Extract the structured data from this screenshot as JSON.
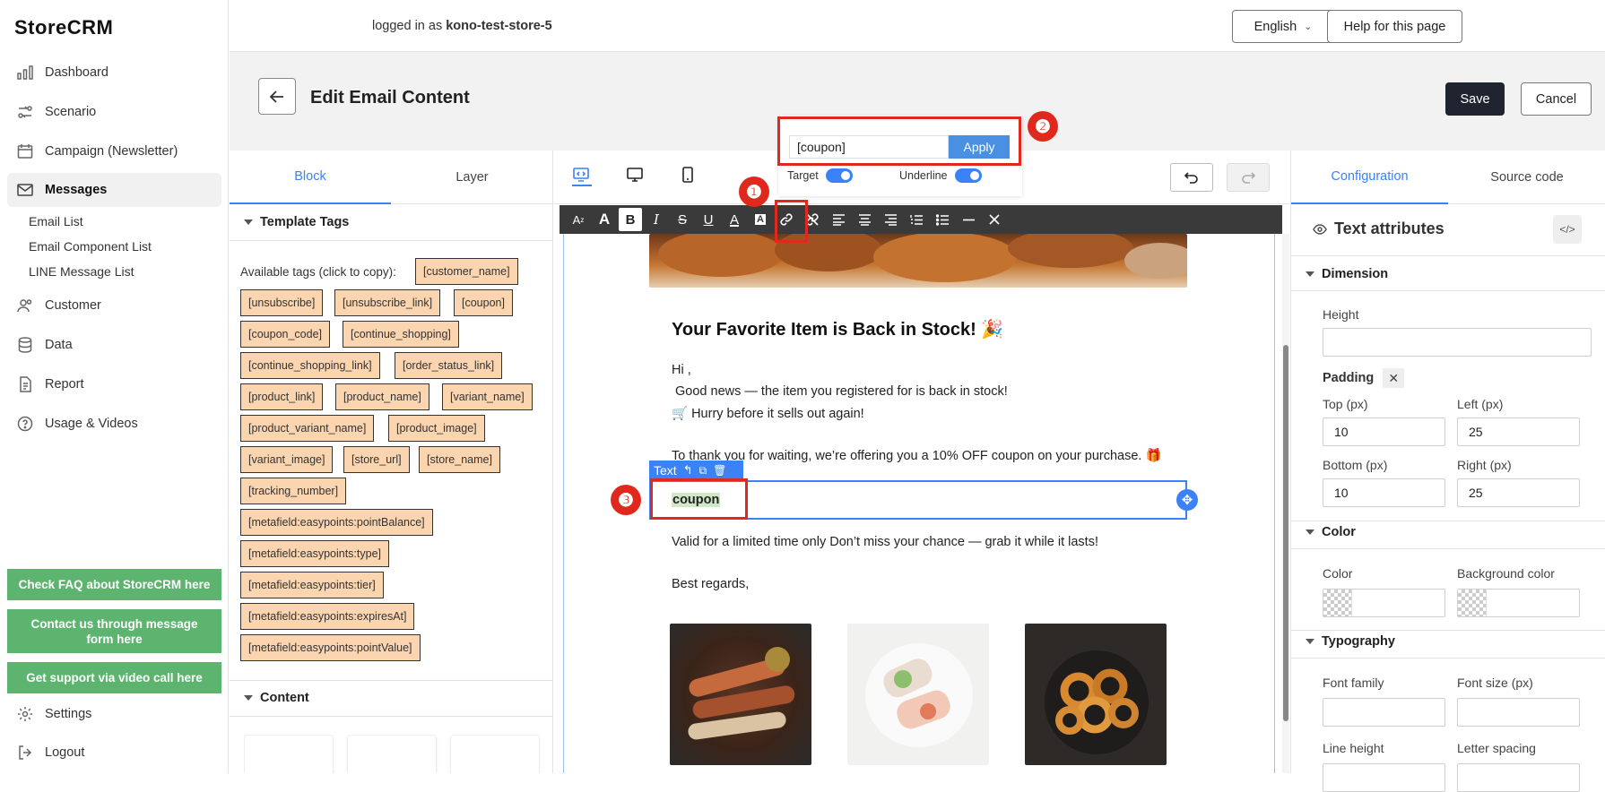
{
  "app": {
    "logo": "StoreCRM"
  },
  "sidebar": {
    "nav": [
      {
        "label": "Dashboard",
        "icon": "dashboard-icon"
      },
      {
        "label": "Scenario",
        "icon": "scenario-icon"
      },
      {
        "label": "Campaign (Newsletter)",
        "icon": "calendar-icon"
      },
      {
        "label": "Messages",
        "icon": "mail-icon"
      },
      {
        "label": "Customer",
        "icon": "users-icon"
      },
      {
        "label": "Data",
        "icon": "database-icon"
      },
      {
        "label": "Report",
        "icon": "report-icon"
      },
      {
        "label": "Usage & Videos",
        "icon": "help-circle-icon"
      }
    ],
    "sub_items": [
      "Email List",
      "Email Component List",
      "LINE Message List"
    ],
    "help_buttons": [
      "Check FAQ about StoreCRM here",
      "Contact us through message form here",
      "Get support via video call here"
    ],
    "settings_label": "Settings",
    "logout_label": "Logout"
  },
  "topbar": {
    "login_prefix": "logged in as ",
    "store_name": "kono-test-store-5",
    "language": "English",
    "help_label": "Help for this page"
  },
  "page": {
    "title": "Edit Email Content",
    "save_label": "Save",
    "cancel_label": "Cancel"
  },
  "left_panel": {
    "tabs": [
      "Block",
      "Layer"
    ],
    "template_tags_header": "Template Tags",
    "tags_intro": "Available tags (click to copy):",
    "tags": [
      "[customer_name]",
      "[unsubscribe]",
      "[unsubscribe_link]",
      "[coupon]",
      "[coupon_code]",
      "[continue_shopping]",
      "[continue_shopping_link]",
      "[order_status_link]",
      "[product_link]",
      "[product_name]",
      "[variant_name]",
      "[product_variant_name]",
      "[product_image]",
      "[variant_image]",
      "[store_url]",
      "[store_name]",
      "[tracking_number]",
      "[metafield:easypoints:pointBalance]",
      "[metafield:easypoints:type]",
      "[metafield:easypoints:tier]",
      "[metafield:easypoints:expiresAt]",
      "[metafield:easypoints:pointValue]"
    ],
    "content_header": "Content"
  },
  "link_popup": {
    "input_value": "[coupon]",
    "apply_label": "Apply",
    "target_label": "Target",
    "underline_label": "Underline"
  },
  "annotations": [
    "❶",
    "❷",
    "❸"
  ],
  "email": {
    "heading": "Your Favorite Item is Back in Stock! 🎉",
    "greeting": "Hi ,",
    "line1": " Good news — the item you registered for is back in stock!",
    "line2": "🛒 Hurry before it sells out again!",
    "line3": "To thank you for waiting, we’re offering you a 10% OFF coupon on your purchase. 🎁",
    "selected_label": "Text",
    "coupon_text": "coupon",
    "line4": "Valid for a limited time only Don’t miss your chance — grab it while it lasts!",
    "closing": "Best regards,"
  },
  "right_panel": {
    "tabs": [
      "Configuration",
      "Source code"
    ],
    "section_title": "Text attributes",
    "dimension_header": "Dimension",
    "height_label": "Height",
    "height_value": "",
    "padding_label": "Padding",
    "top_label": "Top (px)",
    "top_value": "10",
    "left_label": "Left (px)",
    "left_value": "25",
    "bottom_label": "Bottom (px)",
    "bottom_value": "10",
    "right_label": "Right (px)",
    "right_value": "25",
    "color_header": "Color",
    "color_label": "Color",
    "bg_color_label": "Background color",
    "typography_header": "Typography",
    "font_family_label": "Font family",
    "font_size_label": "Font size (px)",
    "line_height_label": "Line height",
    "letter_spacing_label": "Letter spacing"
  },
  "colors": {
    "accent": "#3b82f6",
    "tag_bg": "#fbd5b0",
    "green": "#5cb46f",
    "red": "#e0291c",
    "toolbar": "#3a3a3a",
    "save_bg": "#1f2430"
  }
}
